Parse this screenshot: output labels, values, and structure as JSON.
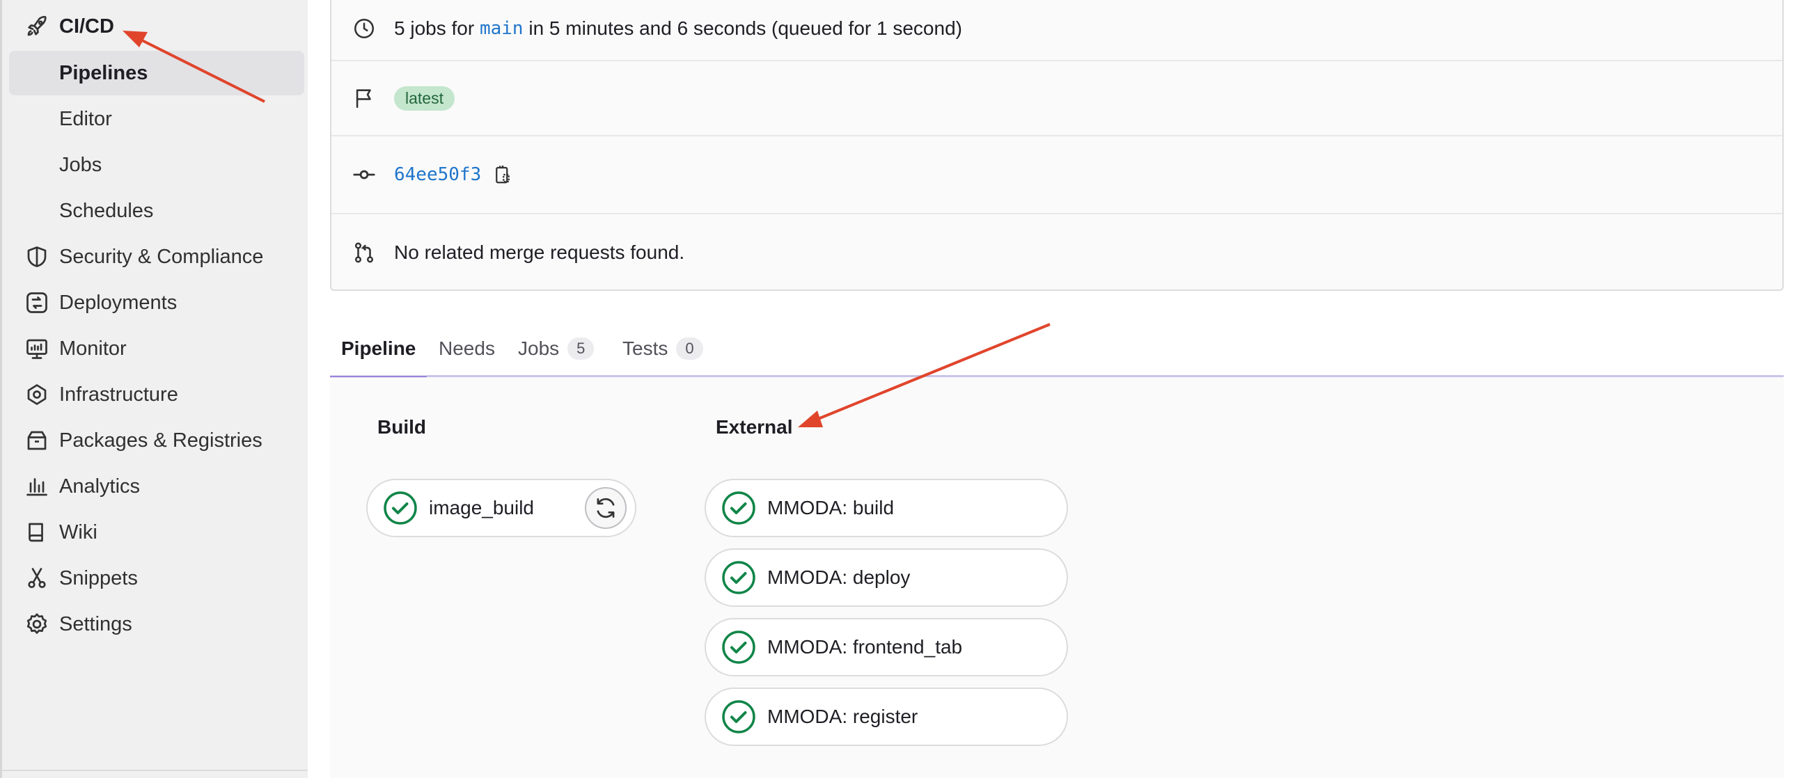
{
  "sidebar": {
    "items": [
      {
        "label": "CI/CD",
        "icon": "rocket-icon"
      },
      {
        "label": "Pipelines"
      },
      {
        "label": "Editor"
      },
      {
        "label": "Jobs"
      },
      {
        "label": "Schedules"
      },
      {
        "label": "Security & Compliance",
        "icon": "shield-icon"
      },
      {
        "label": "Deployments",
        "icon": "deployments-icon"
      },
      {
        "label": "Monitor",
        "icon": "monitor-icon"
      },
      {
        "label": "Infrastructure",
        "icon": "cloud-gear-icon"
      },
      {
        "label": "Packages & Registries",
        "icon": "package-icon"
      },
      {
        "label": "Analytics",
        "icon": "chart-icon"
      },
      {
        "label": "Wiki",
        "icon": "book-icon"
      },
      {
        "label": "Snippets",
        "icon": "scissors-icon"
      },
      {
        "label": "Settings",
        "icon": "gear-icon"
      }
    ]
  },
  "info": {
    "jobs_prefix": "5 jobs for",
    "branch": "main",
    "jobs_suffix": "in 5 minutes and 6 seconds (queued for 1 second)",
    "badge": "latest",
    "commit": "64ee50f3",
    "merge_requests": "No related merge requests found."
  },
  "tabs": [
    {
      "label": "Pipeline"
    },
    {
      "label": "Needs"
    },
    {
      "label": "Jobs",
      "count": "5"
    },
    {
      "label": "Tests",
      "count": "0"
    }
  ],
  "stages": [
    {
      "title": "Build",
      "jobs": [
        {
          "name": "image_build",
          "status": "success"
        }
      ]
    },
    {
      "title": "External",
      "jobs": [
        {
          "name": "MMODA: build",
          "status": "success"
        },
        {
          "name": "MMODA: deploy",
          "status": "success"
        },
        {
          "name": "MMODA: frontend_tab",
          "status": "success"
        },
        {
          "name": "MMODA: register",
          "status": "success"
        }
      ]
    }
  ],
  "colors": {
    "success": "#108548",
    "link": "#1f75cb",
    "tab_active": "#6e49cb",
    "annotation": "#e0452c"
  }
}
